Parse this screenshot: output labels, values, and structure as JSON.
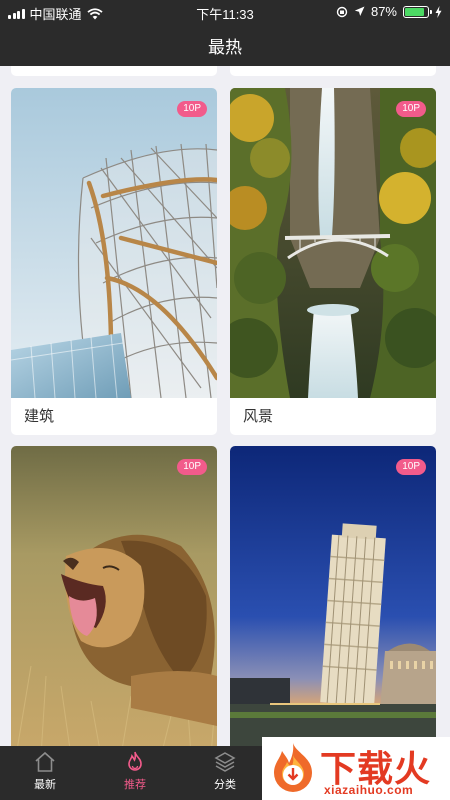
{
  "status_bar": {
    "carrier": "中国联通",
    "time": "下午11:33",
    "battery_percent": "87%",
    "battery_level": 0.87,
    "accent": "#4cd964"
  },
  "nav": {
    "title": "最热"
  },
  "cards": [
    {
      "badge": "10P",
      "caption": "建筑"
    },
    {
      "badge": "10P",
      "caption": "风景"
    },
    {
      "badge": "10P",
      "caption": ""
    },
    {
      "badge": "10P",
      "caption": ""
    }
  ],
  "tabbar": {
    "items": [
      {
        "label": "最新",
        "icon": "home-icon"
      },
      {
        "label": "推荐",
        "icon": "flame-icon",
        "active": true
      },
      {
        "label": "分类",
        "icon": "layers-icon"
      }
    ],
    "active_color": "#f25b8b"
  },
  "watermark": {
    "brand": "下载火",
    "url": "xiazaihuo.com"
  }
}
